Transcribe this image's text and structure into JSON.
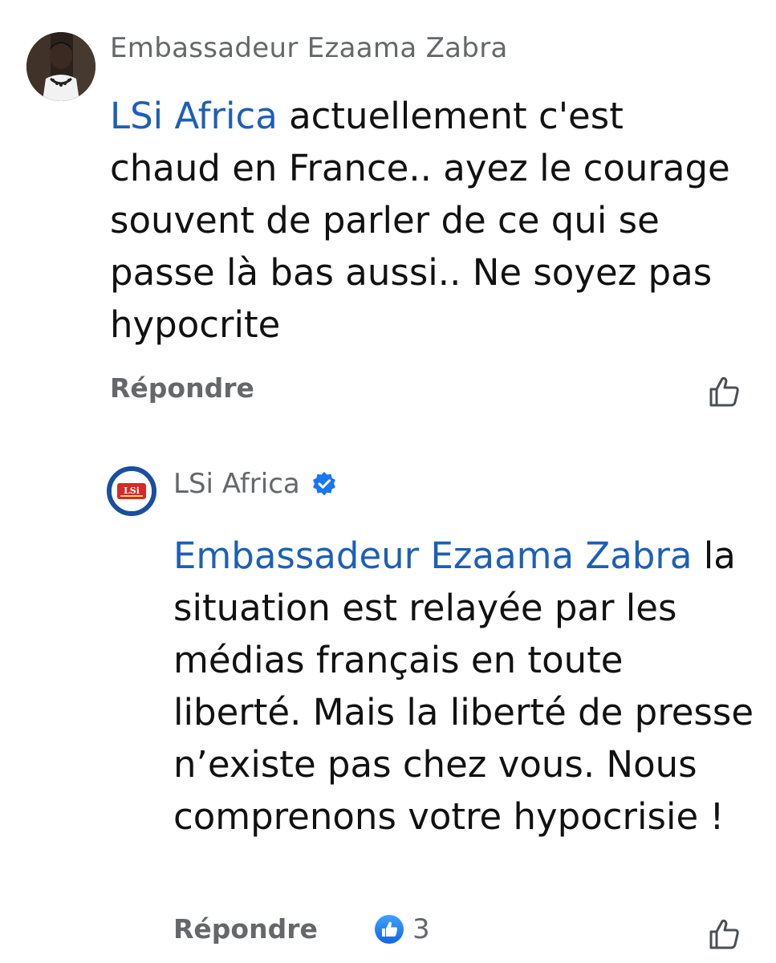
{
  "comments": [
    {
      "author": "Embassadeur Ezaama Zabra",
      "avatar_icon": "user-photo-avatar",
      "mention": "LSi Africa",
      "text": " actuellement c'est chaud en France.. ayez le courage souvent de parler de ce qui se passe là bas aussi.. Ne soyez pas hypocrite",
      "reply_label": "Répondre",
      "like_icon": "thumbs-up-outline-icon"
    },
    {
      "author": "LSi Africa",
      "avatar_icon": "lsi-africa-logo",
      "avatar_logo_text": "LSi",
      "verified": true,
      "verified_icon": "verified-badge-icon",
      "mention": "Embassadeur Ezaama Zabra",
      "text": " la situation est relayée par les médias français en toute liberté. Mais la liberté de presse n’existe pas chez vous. Nous comprenons votre hypocrisie  !",
      "reply_label": "Répondre",
      "reaction_icon": "like-reaction-icon",
      "reaction_count": "3",
      "like_icon": "thumbs-up-outline-icon"
    }
  ],
  "colors": {
    "mention": "#1c5fb8",
    "meta_gray": "#65676b",
    "text": "#111111",
    "verified_blue": "#1877f2",
    "logo_red": "#d42a2a",
    "logo_ring": "#1a4fa0"
  }
}
